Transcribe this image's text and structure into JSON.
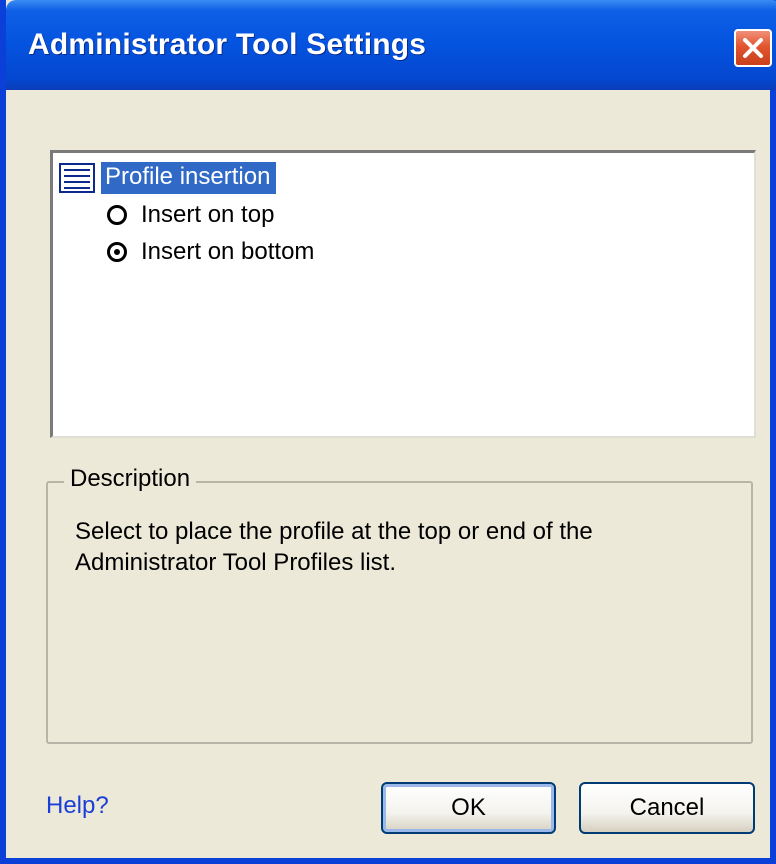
{
  "window": {
    "title": "Administrator Tool Settings",
    "close_icon": "close-icon",
    "accent": "#0453df"
  },
  "tree": {
    "node": {
      "icon": "list-icon",
      "label": "Profile insertion",
      "selected": true
    },
    "options": [
      {
        "label": "Insert on top",
        "checked": false
      },
      {
        "label": "Insert on bottom",
        "checked": true
      }
    ]
  },
  "description": {
    "legend": "Description",
    "text": "Select to place the profile at the top or end of the Administrator Tool Profiles list."
  },
  "footer": {
    "help_label": "Help?",
    "ok_label": "OK",
    "cancel_label": "Cancel"
  }
}
